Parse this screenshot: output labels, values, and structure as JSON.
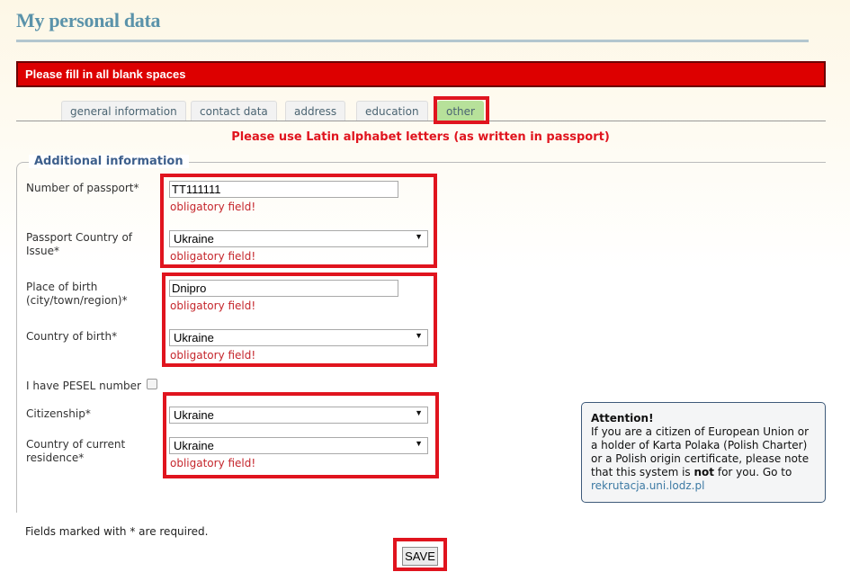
{
  "page": {
    "title": "My personal data"
  },
  "error_banner": "Please fill in all blank spaces",
  "tabs": [
    {
      "label": "general information",
      "active": false
    },
    {
      "label": "contact data",
      "active": false
    },
    {
      "label": "address",
      "active": false
    },
    {
      "label": "education",
      "active": false
    },
    {
      "label": "other",
      "active": true
    }
  ],
  "latin_note": "Please use Latin alphabet letters (as written in passport)",
  "section": {
    "legend": "Additional information",
    "fields": {
      "passport_number": {
        "label": "Number of passport*",
        "value": "TT111111",
        "error": "obligatory field!"
      },
      "passport_country": {
        "label": "Passport Country of Issue*",
        "value": "Ukraine",
        "error": "obligatory field!"
      },
      "place_of_birth": {
        "label": "Place of birth (city/town/region)*",
        "value": "Dnipro",
        "error": "obligatory field!"
      },
      "country_of_birth": {
        "label": "Country of birth*",
        "value": "Ukraine",
        "error": "obligatory field!"
      },
      "pesel": {
        "label": "I have PESEL number",
        "checked": false
      },
      "citizenship": {
        "label": "Citizenship*",
        "value": "Ukraine"
      },
      "residence": {
        "label": "Country of current residence*",
        "value": "Ukraine",
        "error": "obligatory field!"
      }
    }
  },
  "attention": {
    "title": "Attention!",
    "text_before": "If you are a citizen of European Union or a holder of Karta Polaka (Polish Charter) or a Polish origin certificate, please note that this system is ",
    "emphasis": "not",
    "text_after": " for you. Go to",
    "link": "rekrutacja.uni.lodz.pl"
  },
  "footer": {
    "required_note": "Fields marked with * are required.",
    "save_label": "SAVE"
  },
  "colors": {
    "title": "#5b93aa",
    "error_banner": "#dd0000",
    "active_tab": "#b7e19a",
    "highlight": "#e0141e",
    "error_text": "#c5262c"
  }
}
